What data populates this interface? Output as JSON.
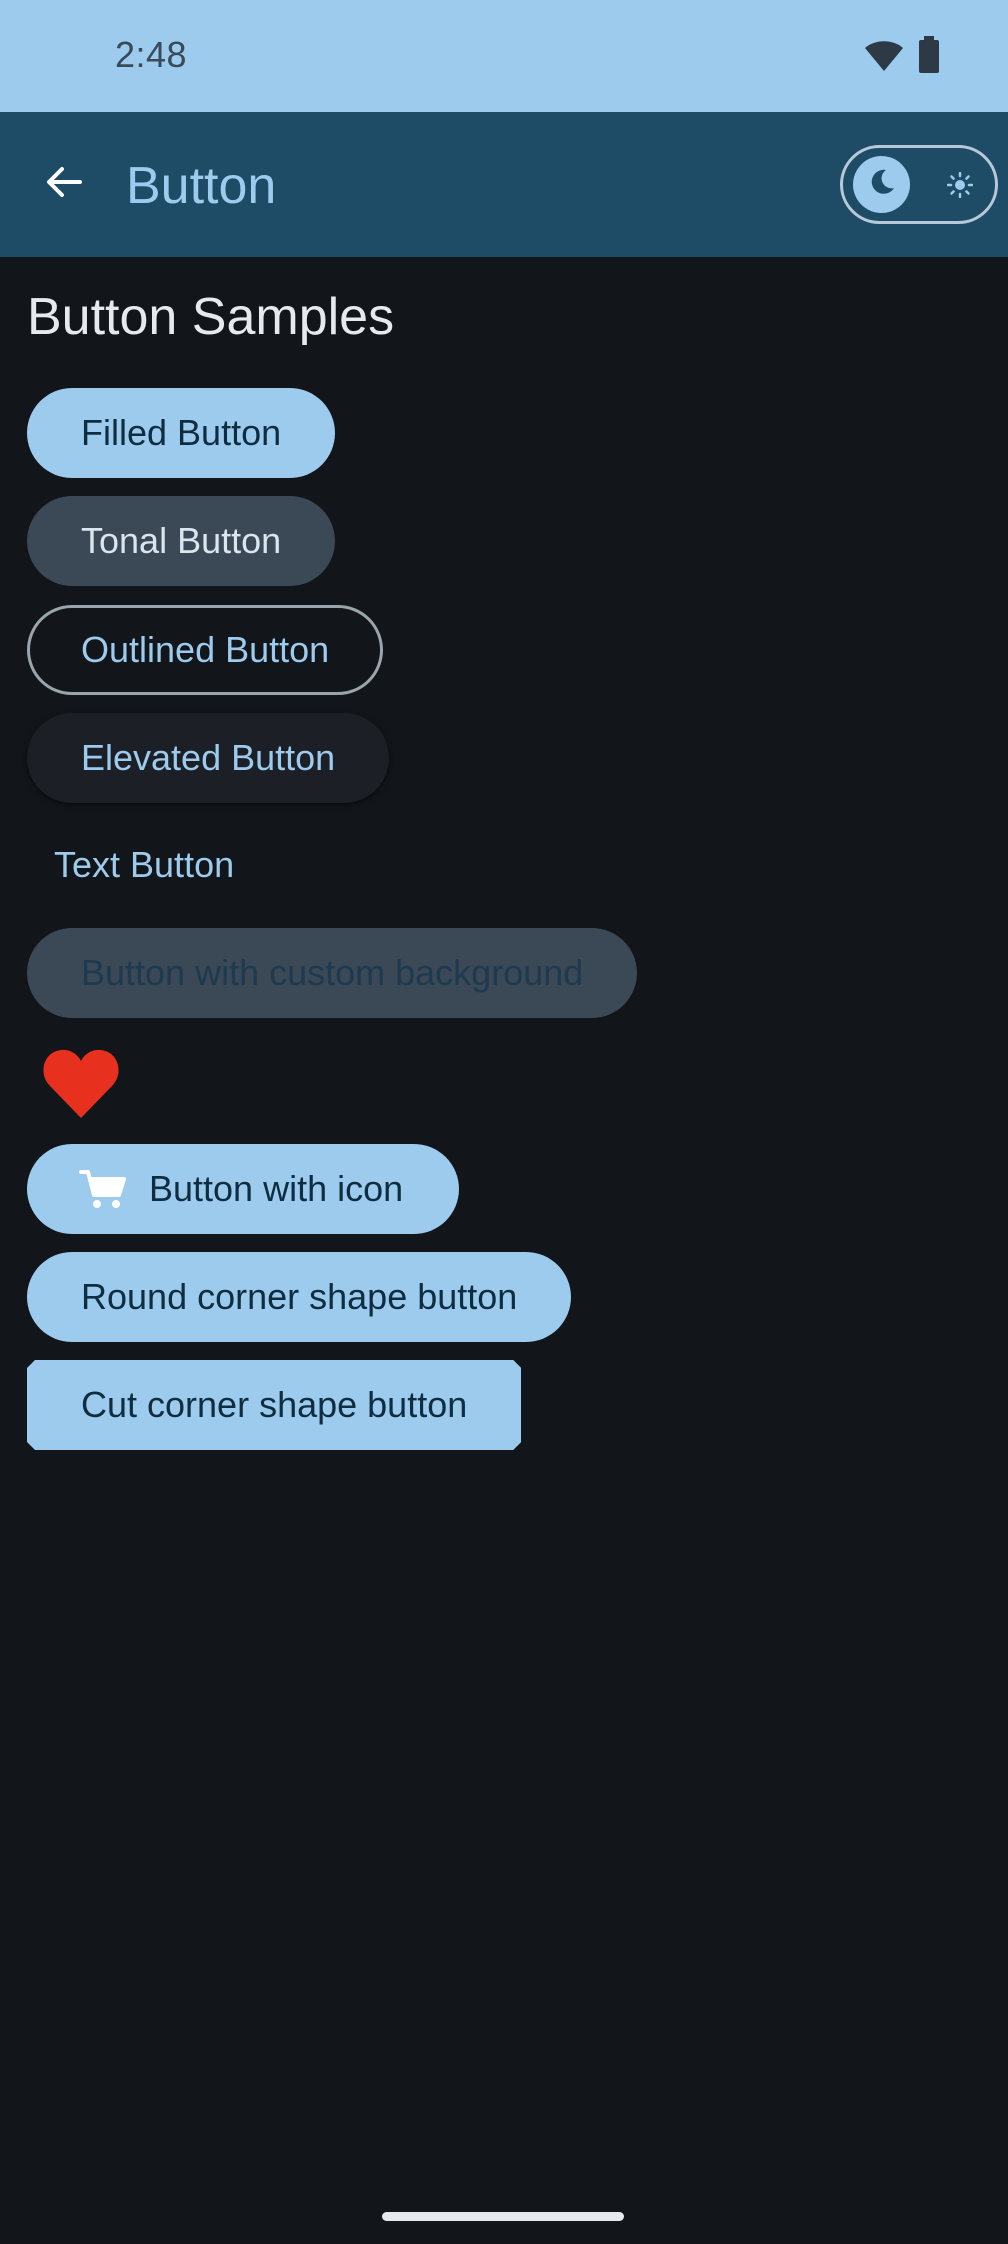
{
  "status_bar": {
    "time": "2:48"
  },
  "app_bar": {
    "title": "Button"
  },
  "content": {
    "section_title": "Button Samples",
    "buttons": {
      "filled": "Filled Button",
      "tonal": "Tonal Button",
      "outlined": "Outlined Button",
      "elevated": "Elevated Button",
      "text": "Text Button",
      "custom_background": "Button with custom background",
      "with_icon": "Button with icon",
      "round_corner": "Round corner shape button",
      "cut_corner": "Cut corner shape button"
    }
  },
  "icons": {
    "back": "arrow-back-icon",
    "theme_dark": "moon-icon",
    "theme_light": "sun-icon",
    "favorite": "heart-icon",
    "cart": "shopping-cart-icon",
    "wifi": "wifi-icon",
    "battery": "battery-icon"
  },
  "colors": {
    "status_bar": "#9ccbee",
    "app_bar": "#1e4b66",
    "background": "#121519",
    "primary": "#9ccbee",
    "heart": "#e8301f"
  }
}
